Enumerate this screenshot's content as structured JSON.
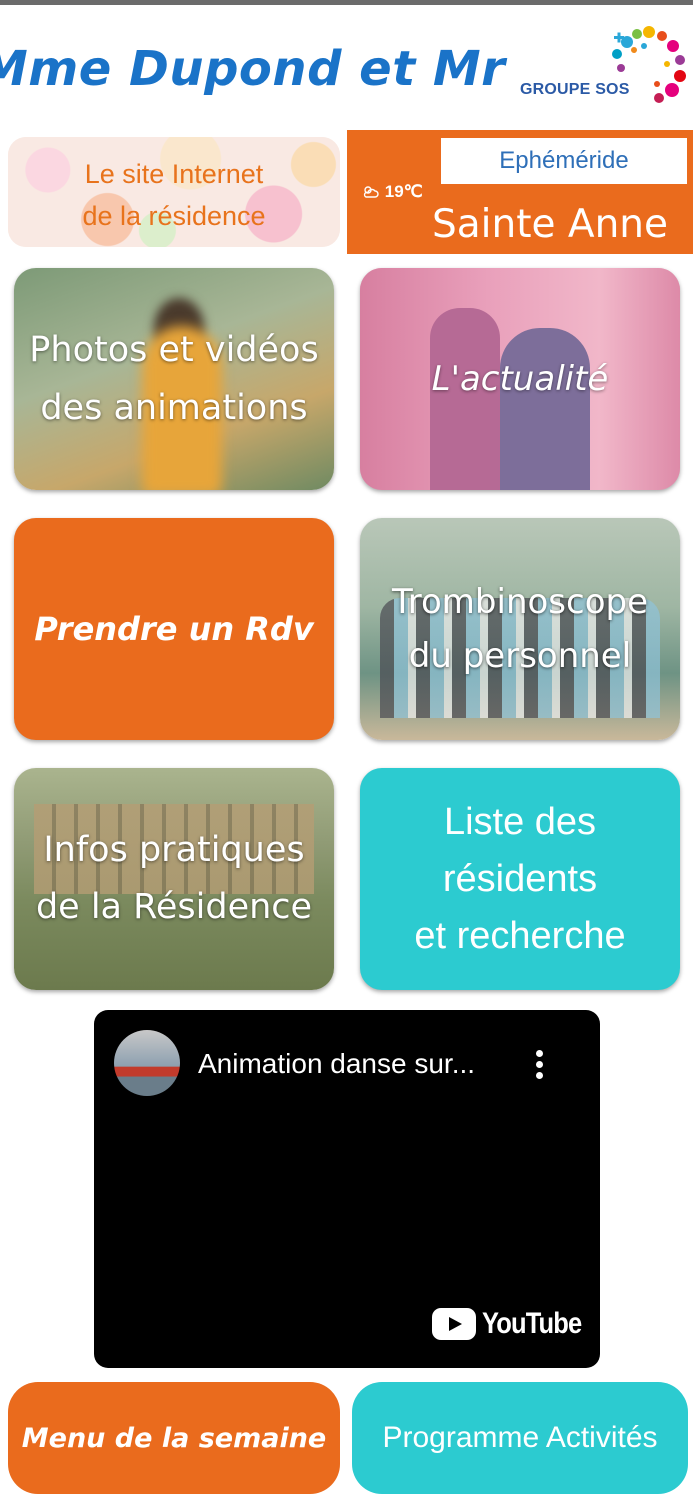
{
  "header": {
    "title": "Mme Dupond et Mr Ma",
    "logo_text": "GROUPE SOS"
  },
  "site_card": {
    "line1": "Le site Internet",
    "line2": "de la résidence"
  },
  "ephemeride": {
    "label": "Ephéméride",
    "weather": "19℃",
    "weather_icon": "partly-cloudy-icon",
    "saint": "Sainte Anne"
  },
  "tiles": {
    "photos": {
      "line1": "Photos et vidéos",
      "line2": "des animations"
    },
    "actualite": {
      "label": "L'actualité"
    },
    "rdv": {
      "label": "Prendre un Rdv"
    },
    "trombinoscope": {
      "line1": "Trombinoscope",
      "line2": "du personnel"
    },
    "infos": {
      "line1": "Infos pratiques",
      "line2": "de la Résidence"
    },
    "liste": {
      "line1": "Liste des",
      "line2": "résidents",
      "line3": "et recherche"
    }
  },
  "video": {
    "title": "Animation danse sur...",
    "brand": "YouTube"
  },
  "bottom": {
    "menu": "Menu de la semaine",
    "programme": "Programme Activités"
  },
  "colors": {
    "orange": "#ea6b1d",
    "turquoise": "#2ccbd0",
    "title_blue": "#1a73c8"
  }
}
